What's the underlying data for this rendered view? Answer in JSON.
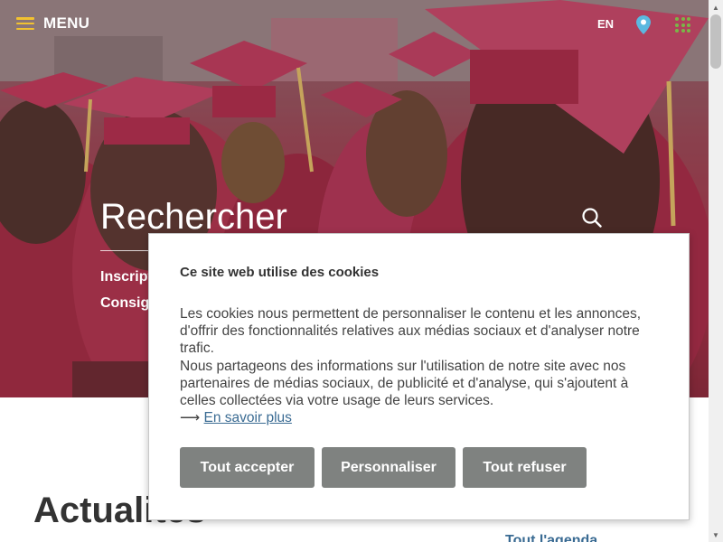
{
  "header": {
    "menu_label": "MENU",
    "language_label": "EN",
    "icons": {
      "menu": "hamburger-icon",
      "location": "map-pin-icon",
      "apps": "grid-dots-icon"
    },
    "colors": {
      "menu_icon": "#f2c230",
      "pin": "#5bb8e0",
      "grid": "#7ab648"
    }
  },
  "hero": {
    "search_title": "Rechercher",
    "search_icon": "search-icon",
    "quick_links": [
      "Inscriptions",
      "Consignes"
    ]
  },
  "content": {
    "section_title": "Actualités",
    "agenda_link": "Tout l'agenda"
  },
  "cookie_banner": {
    "title": "Ce site web utilise des cookies",
    "paragraph_1": "Les cookies nous permettent de personnaliser le contenu et les annonces, d'offrir des fonctionnalités relatives aux médias sociaux et d'analyser notre trafic.",
    "paragraph_2": "Nous partageons des informations sur l'utilisation de notre site avec nos partenaires de médias sociaux, de publicité et d'analyse, qui s'ajoutent à celles collectées via votre usage de leurs services.",
    "learn_more_arrow": "⟶",
    "learn_more_label": "En savoir plus",
    "buttons": {
      "accept": "Tout accepter",
      "customize": "Personnaliser",
      "refuse": "Tout refuser"
    },
    "colors": {
      "button_bg": "#7f8280",
      "link": "#3a6b93"
    }
  }
}
